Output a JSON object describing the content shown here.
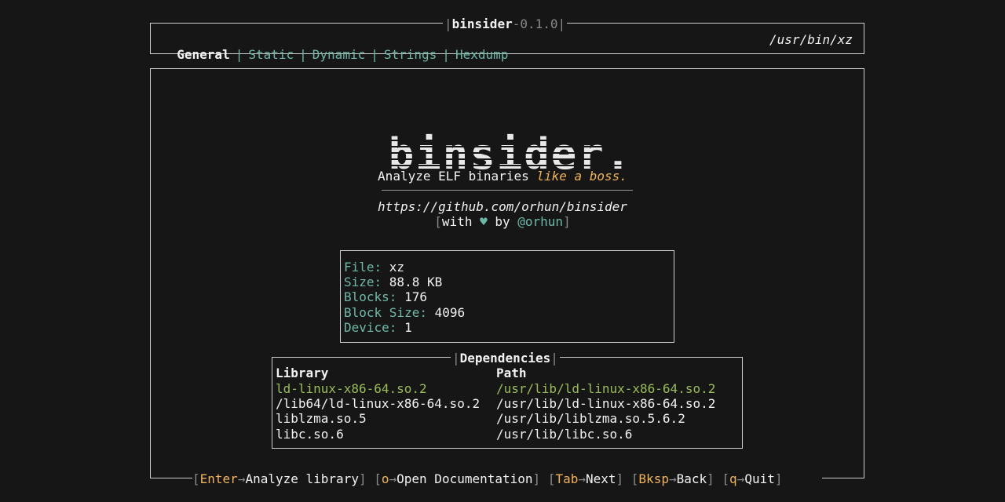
{
  "app": {
    "name": "binsider",
    "version": "0.1.0"
  },
  "tabs": [
    {
      "label": "General",
      "active": true
    },
    {
      "label": "Static",
      "active": false
    },
    {
      "label": "Dynamic",
      "active": false
    },
    {
      "label": "Strings",
      "active": false
    },
    {
      "label": "Hexdump",
      "active": false
    }
  ],
  "file_path": "/usr/bin/xz",
  "splash": {
    "logo_text": "binsider.",
    "tagline_plain": "Analyze ELF binaries ",
    "tagline_emphasis": "like a boss.",
    "repo_url": "https://github.com/orhun/binsider",
    "credits_prefix": "with ",
    "credits_heart": "♥",
    "credits_by": " by ",
    "credits_author": "@orhun"
  },
  "file_info": [
    {
      "label": "File",
      "value": "xz"
    },
    {
      "label": "Size",
      "value": "88.8 KB"
    },
    {
      "label": "Blocks",
      "value": "176"
    },
    {
      "label": "Block Size",
      "value": "4096"
    },
    {
      "label": "Device",
      "value": "1"
    }
  ],
  "dependencies": {
    "title": "Dependencies",
    "headers": [
      "Library",
      "Path"
    ],
    "rows": [
      {
        "library": "ld-linux-x86-64.so.2",
        "path": "/usr/lib/ld-linux-x86-64.so.2",
        "selected": true
      },
      {
        "library": "/lib64/ld-linux-x86-64.so.2",
        "path": "/usr/lib/ld-linux-x86-64.so.2",
        "selected": false
      },
      {
        "library": "liblzma.so.5",
        "path": "/usr/lib/liblzma.so.5.6.2",
        "selected": false
      },
      {
        "library": "libc.so.6",
        "path": "/usr/lib/libc.so.6",
        "selected": false
      }
    ]
  },
  "keybindings": [
    {
      "key": "Enter",
      "arrow": "→",
      "action": "Analyze library"
    },
    {
      "key": "o",
      "arrow": "→",
      "action": "Open Documentation"
    },
    {
      "key": "Tab",
      "arrow": "→",
      "action": "Next"
    },
    {
      "key": "Bksp",
      "arrow": "→",
      "action": "Back"
    },
    {
      "key": "q",
      "arrow": "→",
      "action": "Quit"
    }
  ],
  "colors": {
    "background": "#161616",
    "accent_teal": "#6fb8a8",
    "selected_green": "#9bbb59",
    "key_orange": "#f0b35a",
    "heart": "#6fb8a8"
  }
}
